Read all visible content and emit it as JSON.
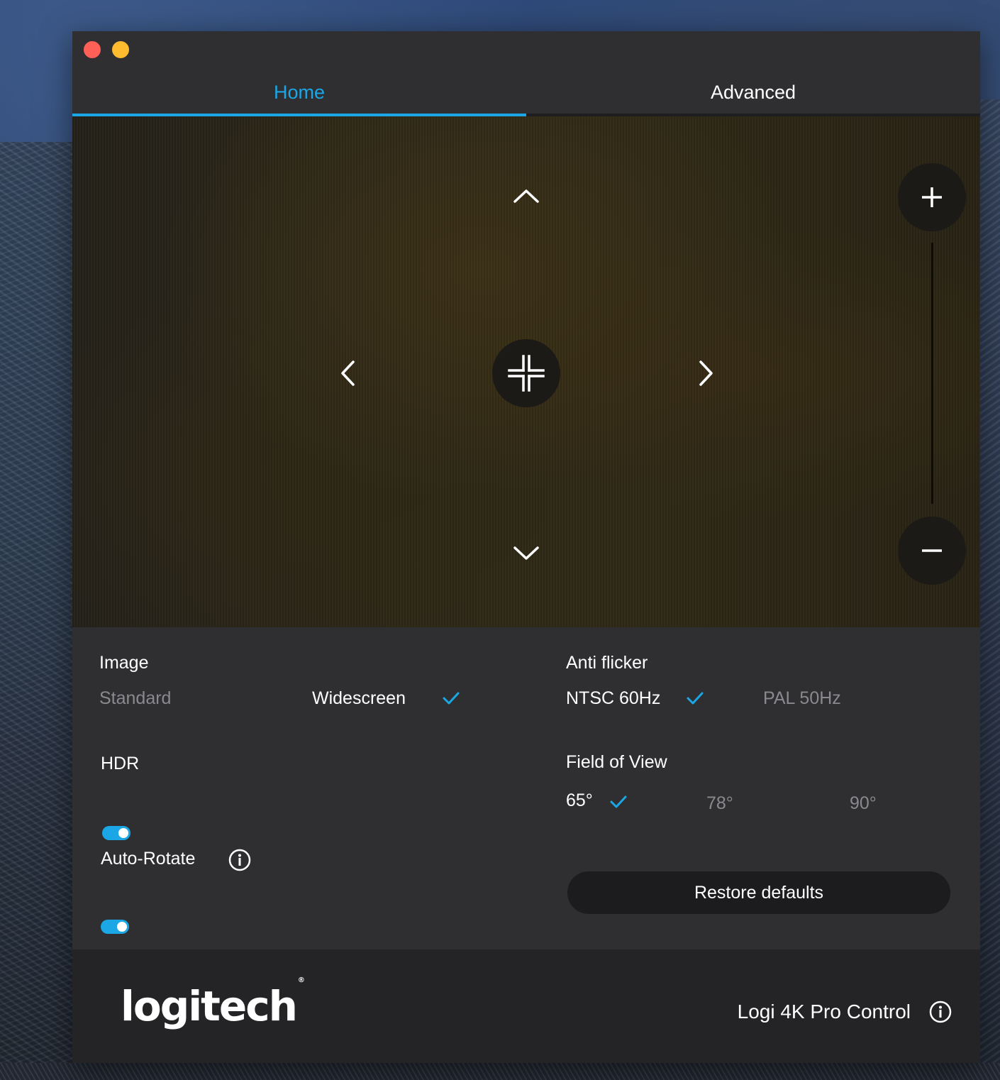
{
  "tabs": [
    {
      "label": "Home",
      "active": true
    },
    {
      "label": "Advanced",
      "active": false
    }
  ],
  "preview": {
    "pan_up_icon": "chevron-up-icon",
    "pan_down_icon": "chevron-down-icon",
    "pan_left_icon": "chevron-left-icon",
    "pan_right_icon": "chevron-right-icon",
    "center_icon": "center-icon",
    "zoom_in_icon": "plus-icon",
    "zoom_out_icon": "minus-icon"
  },
  "image": {
    "label": "Image",
    "options": [
      {
        "label": "Standard",
        "selected": false
      },
      {
        "label": "Widescreen",
        "selected": true
      }
    ]
  },
  "anti_flicker": {
    "label": "Anti flicker",
    "options": [
      {
        "label": "NTSC 60Hz",
        "selected": true
      },
      {
        "label": "PAL 50Hz",
        "selected": false
      }
    ]
  },
  "hdr": {
    "label": "HDR",
    "enabled": true
  },
  "field_of_view": {
    "label": "Field of View",
    "options": [
      {
        "label": "65°",
        "selected": true
      },
      {
        "label": "78°",
        "selected": false
      },
      {
        "label": "90°",
        "selected": false
      }
    ]
  },
  "auto_rotate": {
    "label": "Auto-Rotate",
    "enabled": true
  },
  "restore_defaults": "Restore defaults",
  "footer": {
    "logo": "logitech",
    "product_name": "Logi 4K Pro Control"
  },
  "colors": {
    "accent": "#1ba7e5",
    "window_bg": "#2f2f32",
    "footer_bg": "#242426",
    "inactive_text": "#8a8a8e"
  }
}
